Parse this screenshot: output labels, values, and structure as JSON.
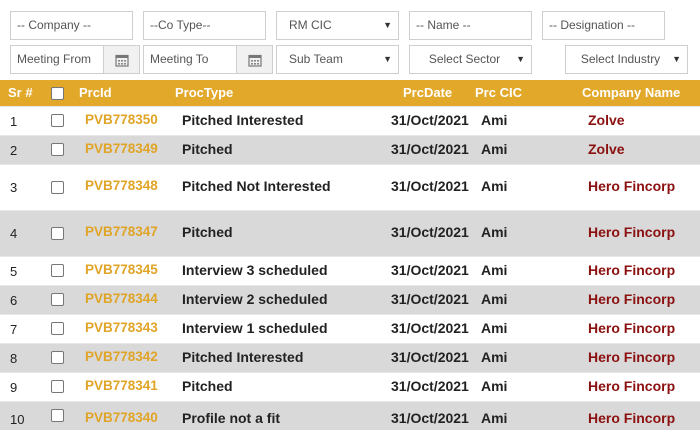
{
  "filters": {
    "company": "-- Company --",
    "co_type": "--Co Type--",
    "rm_cic": "RM CIC",
    "name": "-- Name --",
    "designation": "-- Designation --",
    "meeting_from": "Meeting From",
    "meeting_to": "Meeting To",
    "sub_team": "Sub Team",
    "sector": "Select Sector",
    "industry": "Select Industry"
  },
  "icons": {
    "dropdown": "caret-down-icon",
    "calendar": "calendar-icon"
  },
  "colors": {
    "header_bg": "#e2a82a",
    "id_link": "#e0a426",
    "company": "#8b1010",
    "alt_row": "#d9d9d9"
  },
  "table": {
    "headers": {
      "sr": "Sr #",
      "procid": "PrcId",
      "proctype": "ProcType",
      "procdate": "PrcDate",
      "prccic": "Prc CIC",
      "company": "Company Name"
    },
    "rows": [
      {
        "sr": "1",
        "id": "PVB778350",
        "type": "Pitched Interested",
        "date": "31/Oct/2021",
        "cic": "Ami",
        "company": "Zolve"
      },
      {
        "sr": "2",
        "id": "PVB778349",
        "type": "Pitched",
        "date": "31/Oct/2021",
        "cic": "Ami",
        "company": "Zolve"
      },
      {
        "sr": "3",
        "id": "PVB778348",
        "type": "Pitched Not Interested",
        "date": "31/Oct/2021",
        "cic": "Ami",
        "company": "Hero Fincorp"
      },
      {
        "sr": "4",
        "id": "PVB778347",
        "type": "Pitched",
        "date": "31/Oct/2021",
        "cic": "Ami",
        "company": "Hero Fincorp"
      },
      {
        "sr": "5",
        "id": "PVB778345",
        "type": "Interview 3 scheduled",
        "date": "31/Oct/2021",
        "cic": "Ami",
        "company": "Hero Fincorp"
      },
      {
        "sr": "6",
        "id": "PVB778344",
        "type": "Interview 2 scheduled",
        "date": "31/Oct/2021",
        "cic": "Ami",
        "company": "Hero Fincorp"
      },
      {
        "sr": "7",
        "id": "PVB778343",
        "type": "Interview 1 scheduled",
        "date": "31/Oct/2021",
        "cic": "Ami",
        "company": "Hero Fincorp"
      },
      {
        "sr": "8",
        "id": "PVB778342",
        "type": "Pitched Interested",
        "date": "31/Oct/2021",
        "cic": "Ami",
        "company": "Hero Fincorp"
      },
      {
        "sr": "9",
        "id": "PVB778341",
        "type": "Pitched",
        "date": "31/Oct/2021",
        "cic": "Ami",
        "company": "Hero Fincorp"
      },
      {
        "sr": "10",
        "id": "PVB778340",
        "type": "Profile not a fit",
        "date": "31/Oct/2021",
        "cic": "Ami",
        "company": "Hero Fincorp"
      }
    ]
  }
}
